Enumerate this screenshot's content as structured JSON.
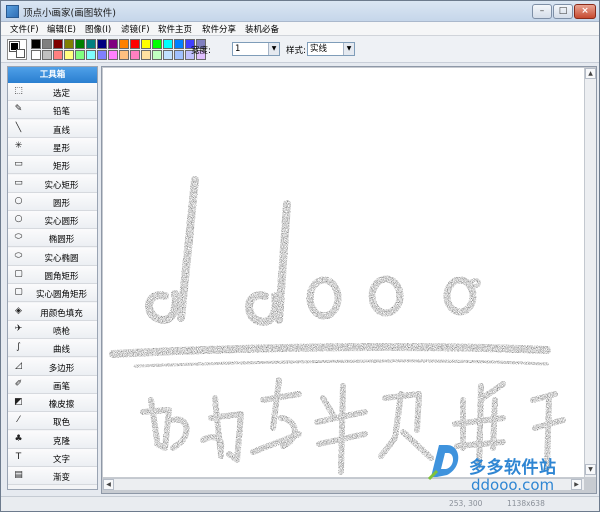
{
  "window": {
    "title": "顶点小画家(画图软件)",
    "minimize_glyph": "–",
    "maximize_glyph": "□",
    "close_glyph": "×"
  },
  "menu": [
    "文件(F)",
    "编辑(E)",
    "图像(I)",
    "滤镜(F)",
    "软件主页",
    "软件分享",
    "装机必备"
  ],
  "palette": {
    "row1": [
      "#000000",
      "#808080",
      "#800000",
      "#808000",
      "#008000",
      "#008080",
      "#000080",
      "#800080",
      "#ff8000",
      "#ff0000",
      "#ffff00",
      "#00ff00",
      "#00ffff",
      "#0080ff",
      "#4040ff",
      "#8080c0"
    ],
    "row2": [
      "#ffffff",
      "#c0c0c0",
      "#ff8080",
      "#ffff80",
      "#80ff80",
      "#80ffff",
      "#8080ff",
      "#ff80ff",
      "#ffc080",
      "#ff80c0",
      "#ffe0a0",
      "#c0ffc0",
      "#c0e0ff",
      "#a0c0ff",
      "#c0c0ff",
      "#e0c0ff"
    ]
  },
  "toolbar": {
    "width_label": "宽度:",
    "width_value": "1",
    "style_label": "样式:",
    "style_value": "实线"
  },
  "toolbox": {
    "title": "工具箱",
    "tools": [
      {
        "label": "选定",
        "icon": "select-rect-icon",
        "glyph": "⬚"
      },
      {
        "label": "铅笔",
        "icon": "pencil-icon",
        "glyph": "✎"
      },
      {
        "label": "直线",
        "icon": "line-icon",
        "glyph": "╲"
      },
      {
        "label": "星形",
        "icon": "star-icon",
        "glyph": "✳"
      },
      {
        "label": "矩形",
        "icon": "rectangle-icon",
        "glyph": "▭"
      },
      {
        "label": "实心矩形",
        "icon": "filled-rectangle-icon",
        "glyph": "▭"
      },
      {
        "label": "圆形",
        "icon": "circle-icon",
        "glyph": "○"
      },
      {
        "label": "实心圆形",
        "icon": "filled-circle-icon",
        "glyph": "○"
      },
      {
        "label": "椭圆形",
        "icon": "ellipse-icon",
        "glyph": "⬭"
      },
      {
        "label": "实心椭圆",
        "icon": "filled-ellipse-icon",
        "glyph": "⬭"
      },
      {
        "label": "圆角矩形",
        "icon": "rounded-rect-icon",
        "glyph": "▢"
      },
      {
        "label": "实心圆角矩形",
        "icon": "filled-rounded-rect-icon",
        "glyph": "▢"
      },
      {
        "label": "用颜色填充",
        "icon": "paint-bucket-icon",
        "glyph": "◈"
      },
      {
        "label": "喷枪",
        "icon": "airbrush-icon",
        "glyph": "✈"
      },
      {
        "label": "曲线",
        "icon": "curve-icon",
        "glyph": "∫"
      },
      {
        "label": "多边形",
        "icon": "polygon-icon",
        "glyph": "◿"
      },
      {
        "label": "画笔",
        "icon": "brush-icon",
        "glyph": "✐"
      },
      {
        "label": "橡皮擦",
        "icon": "eraser-icon",
        "glyph": "◩"
      },
      {
        "label": "取色",
        "icon": "eyedropper-icon",
        "glyph": "⁄"
      },
      {
        "label": "克隆",
        "icon": "clone-stamp-icon",
        "glyph": "♣"
      },
      {
        "label": "文字",
        "icon": "text-tool-icon",
        "glyph": "T"
      },
      {
        "label": "渐变",
        "icon": "gradient-icon",
        "glyph": "▤"
      }
    ]
  },
  "canvas": {
    "drawn_text_top": "ddooo",
    "drawn_text_bottom": "多多软件"
  },
  "status": {
    "coords": "253, 300",
    "size": "1138x638"
  },
  "watermark": {
    "brand_cn": "多多软件站",
    "url": "ddooo.com"
  }
}
